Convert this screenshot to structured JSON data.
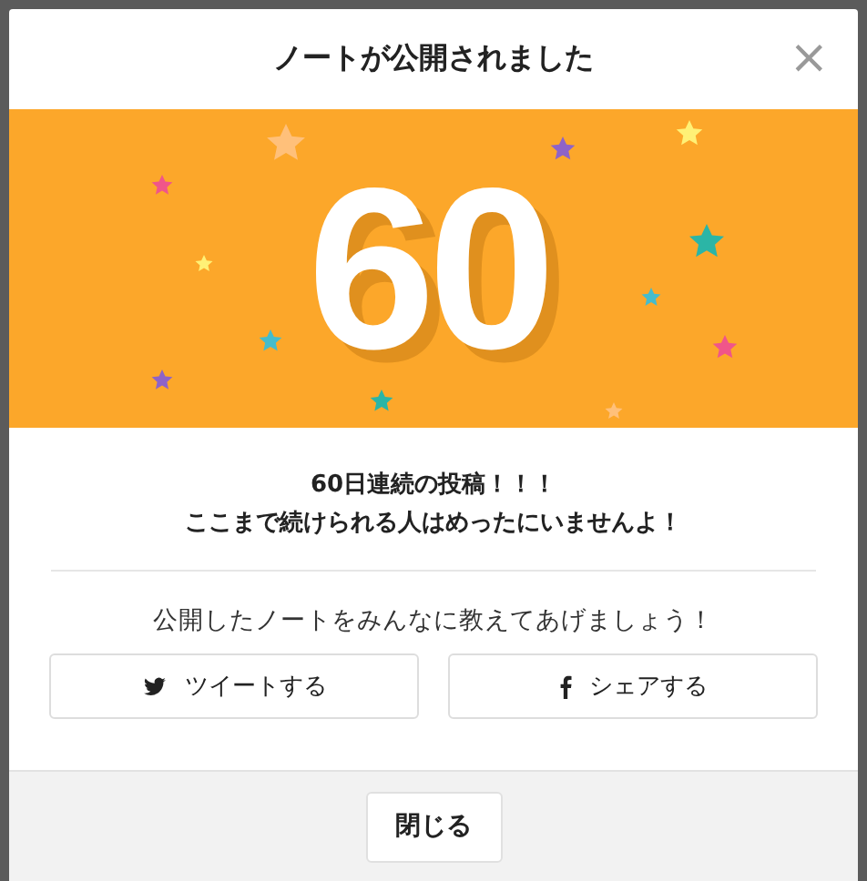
{
  "dialog": {
    "title": "ノートが公開されました",
    "close_icon": "×"
  },
  "banner": {
    "number": "60"
  },
  "message": [
    "60日連続の投稿！！！",
    "ここまで続けられる人はめったにいませんよ！"
  ],
  "share": {
    "prompt": "公開したノートをみんなに教えてあげましょう！",
    "buttons": [
      {
        "kind": "twitter",
        "label": "ツイートする"
      },
      {
        "kind": "facebook",
        "label": "シェアする"
      }
    ]
  },
  "footer": {
    "button": "閉じる"
  }
}
